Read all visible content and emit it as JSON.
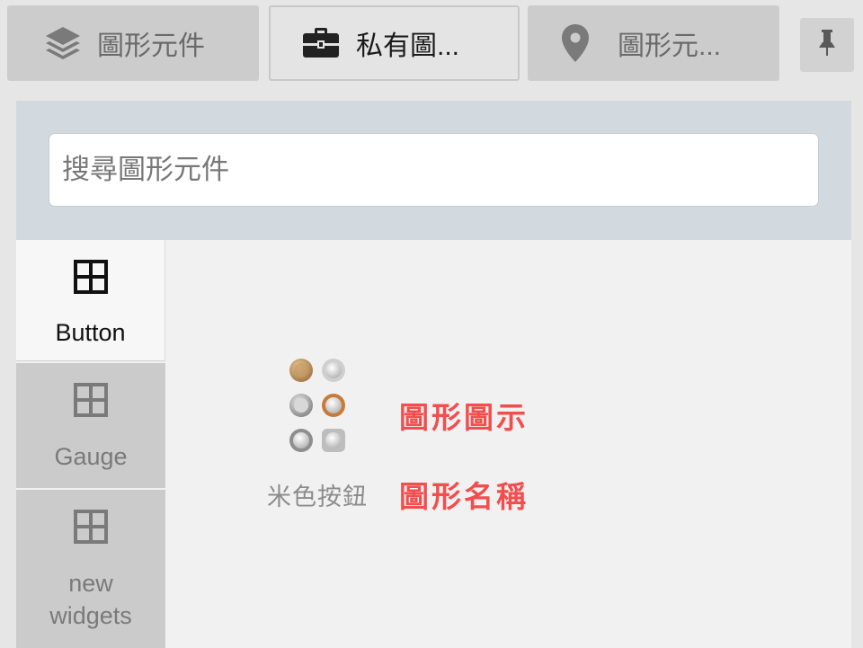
{
  "tabs": [
    {
      "label": "圖形元件",
      "icon": "layers-icon"
    },
    {
      "label": "私有圖...",
      "icon": "briefcase-icon",
      "active": true
    },
    {
      "label": "圖形元...",
      "icon": "map-pin-icon"
    }
  ],
  "pin": {
    "icon": "pin-icon"
  },
  "search": {
    "placeholder": "搜尋圖形元件",
    "value": ""
  },
  "categories": [
    {
      "label": "Button",
      "icon": "grid-icon",
      "active": true
    },
    {
      "label": "Gauge",
      "icon": "grid-icon"
    },
    {
      "label": "new widgets",
      "icon": "grid-icon"
    }
  ],
  "widget": {
    "name": "米色按鈕",
    "icon": "beige-buttons-icon"
  },
  "annotations": {
    "icon_label": "圖形圖示",
    "name_label": "圖形名稱",
    "color": "#f24e4e"
  },
  "colors": {
    "active_tab": "#e4e4e4",
    "inactive_tab": "#cccccc",
    "search_bg": "#d3dadf",
    "panel_bg": "#f1f1f1"
  }
}
